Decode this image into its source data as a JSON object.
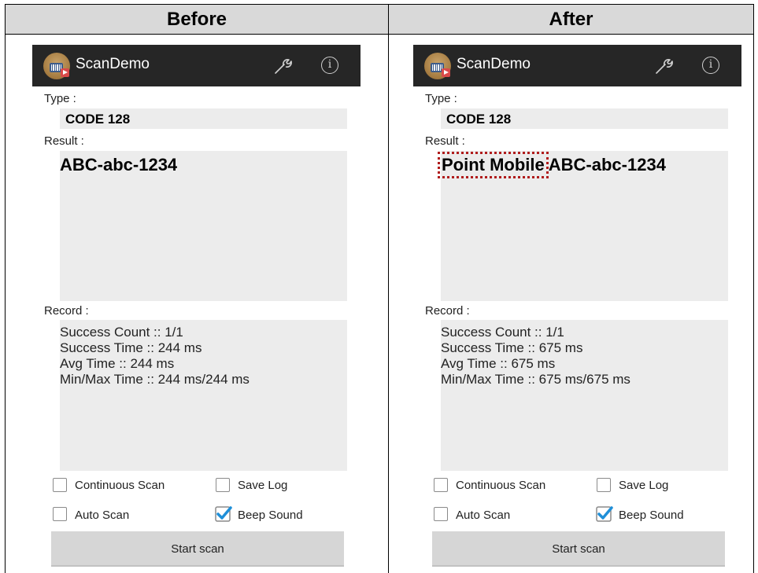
{
  "headers": {
    "before": "Before",
    "after": "After"
  },
  "app": {
    "title": "ScanDemo"
  },
  "labels": {
    "type": "Type :",
    "result": "Result :",
    "record": "Record :"
  },
  "before": {
    "type_value": "CODE 128",
    "result_value": "ABC-abc-1234",
    "record": [
      "Success Count :: 1/1",
      "Success Time :: 244 ms",
      "Avg Time :: 244 ms",
      "Min/Max Time :: 244 ms/244 ms"
    ]
  },
  "after": {
    "type_value": "CODE 128",
    "result_prefix": "Point Mobile",
    "result_value": "ABC-abc-1234",
    "record": [
      "Success Count :: 1/1",
      "Success Time :: 675 ms",
      "Avg Time :: 675 ms",
      "Min/Max Time :: 675 ms/675 ms"
    ]
  },
  "options": {
    "continuous_scan": {
      "label": "Continuous Scan",
      "checked": false
    },
    "save_log": {
      "label": "Save Log",
      "checked": false
    },
    "auto_scan": {
      "label": "Auto Scan",
      "checked": false
    },
    "beep_sound": {
      "label": "Beep Sound",
      "checked": true
    }
  },
  "start_button": "Start scan",
  "icons": {
    "settings": "wrench-icon",
    "info": "info-icon",
    "app": "app-icon",
    "check": "checkmark-icon"
  },
  "colors": {
    "actionbar": "#262626",
    "highlight_border": "#b01c1c",
    "checkbox_checked": "#1f8fd8"
  }
}
